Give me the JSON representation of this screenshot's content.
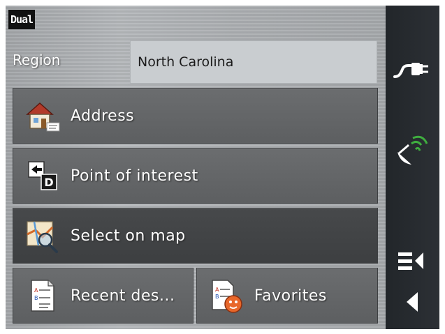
{
  "logo": {
    "text": "Dual"
  },
  "region": {
    "label": "Region",
    "value": "North Carolina"
  },
  "menu": {
    "address": {
      "label": "Address",
      "icon": "house-icon"
    },
    "poi": {
      "label": "Point of interest",
      "icon": "poi-icon"
    },
    "map": {
      "label": "Select on map",
      "icon": "map-search-icon"
    },
    "recent": {
      "label": "Recent des...",
      "icon": "recent-list-icon"
    },
    "favorites": {
      "label": "Favorites",
      "icon": "favorites-icon"
    }
  },
  "sidebar": {
    "icons": [
      "power-plug-icon",
      "satellite-dish-icon",
      "menu-collapse-icon",
      "back-arrow-icon"
    ]
  },
  "colors": {
    "button": "#646668",
    "button_selected": "#424446",
    "sidebar": "#262a2e",
    "field": "#c9cdd0"
  }
}
